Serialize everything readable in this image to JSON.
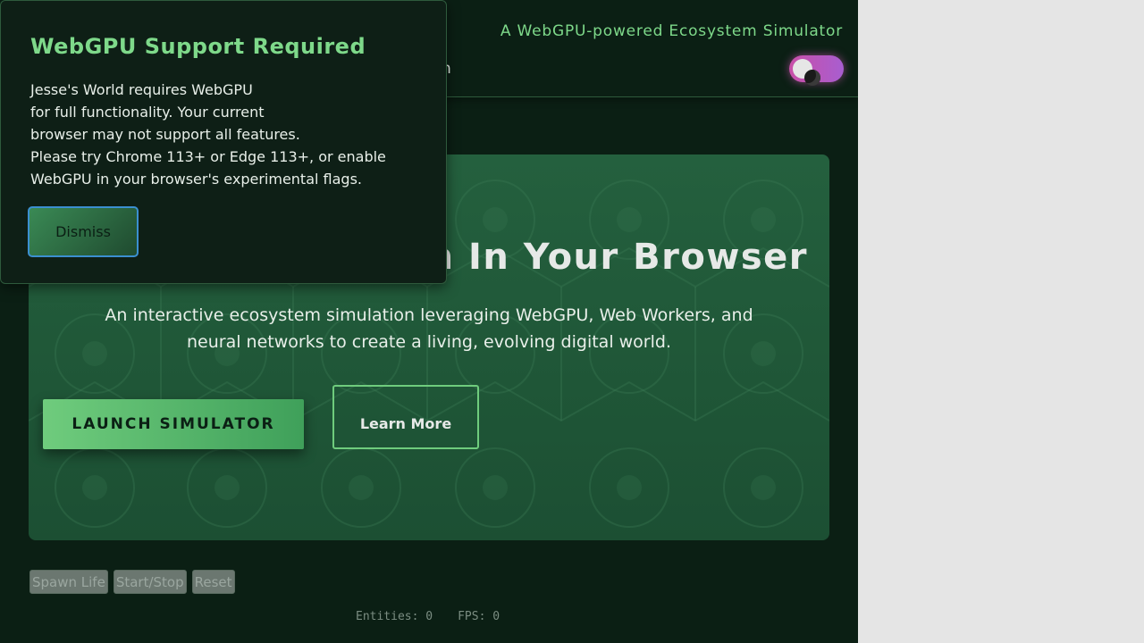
{
  "header": {
    "tagline": "A WebGPU-powered Ecosystem Simulator",
    "nav_partial": "n",
    "theme_toggle_icon": "moon-icon"
  },
  "hero": {
    "title_partial": "on In Your Browser",
    "subtitle": "An interactive ecosystem simulation leveraging WebGPU, Web Workers, and neural networks to create a living, evolving digital world.",
    "launch_label": "LAUNCH SIMULATOR",
    "learn_label": "Learn More"
  },
  "controls": {
    "spawn_label": "Spawn Life",
    "startstop_label": "Start/Stop",
    "reset_label": "Reset"
  },
  "stats": {
    "entities": "Entities: 0",
    "fps": "FPS: 0"
  },
  "modal": {
    "title": "WebGPU Support Required",
    "body_lines": [
      "Jesse's World requires WebGPU",
      "for full functionality. Your current",
      "browser may not support all features.",
      "Please try Chrome 113+ or Edge 113+, or enable",
      "WebGPU in your browser's experimental flags."
    ],
    "dismiss_label": "Dismiss"
  },
  "colors": {
    "background": "#0b1f14",
    "accent": "#7ed98a",
    "hero": "#24603e",
    "toggle": "#c94fa8"
  }
}
